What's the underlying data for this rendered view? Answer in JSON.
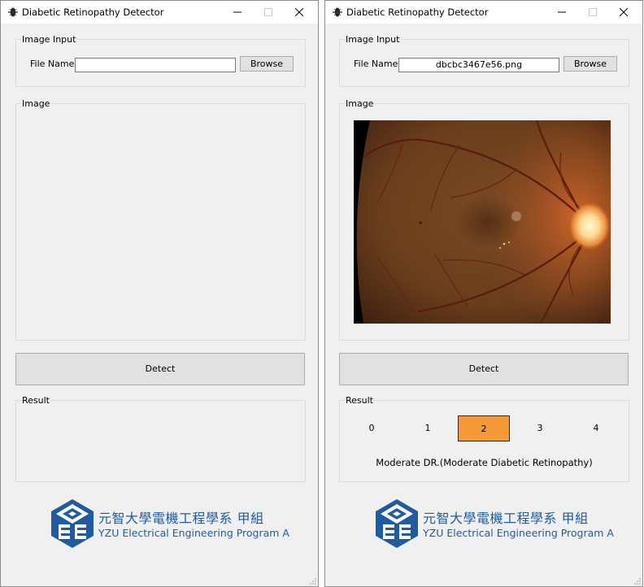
{
  "window_title": "Diabetic Retinopathy Detector",
  "image_input": {
    "legend": "Image Input",
    "file_label": "File Name:",
    "browse_label": "Browse"
  },
  "image_section": {
    "legend": "Image"
  },
  "detect_label": "Detect",
  "result_section": {
    "legend": "Result"
  },
  "logo": {
    "cn_text": "元智大學電機工程學系  甲組",
    "en_text": "YZU Electrical Engineering Program A",
    "color": "#1f5b9e"
  },
  "left_window": {
    "file_value": ""
  },
  "right_window": {
    "file_value": "dbcbc3467e56.png",
    "severity_levels": [
      "0",
      "1",
      "2",
      "3",
      "4"
    ],
    "selected_level": "2",
    "selected_color": "#f59a36",
    "result_text": "Moderate DR.(Moderate Diabetic Retinopathy)"
  }
}
